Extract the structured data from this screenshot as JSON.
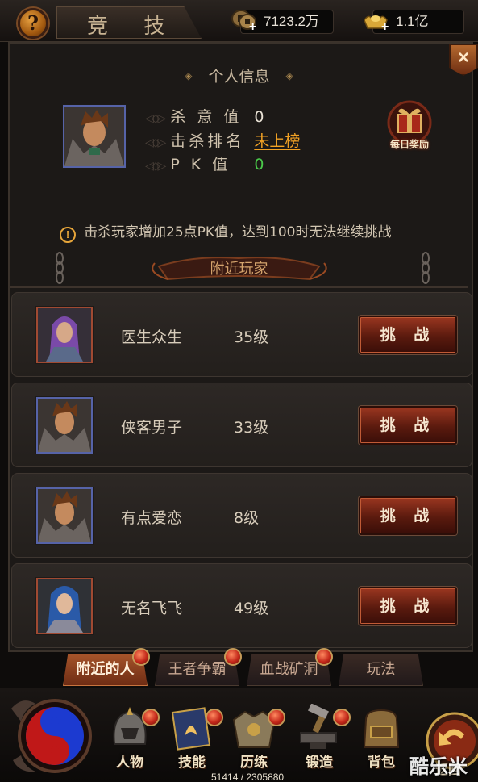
{
  "header": {
    "help_icon_glyph": "?",
    "title": "竞 技",
    "copper_value": "7123.2万",
    "gold_value": "1.1亿",
    "close_glyph": "×"
  },
  "info": {
    "section_title": "个人信息",
    "rows": [
      {
        "label": "杀 意 值",
        "value": "0"
      },
      {
        "label": "击杀排名",
        "value": "未上榜"
      },
      {
        "label": "P  K  值",
        "value": "0"
      }
    ],
    "daily_reward_label": "每日奖励",
    "notice": "击杀玩家增加25点PK值，达到100时无法继续挑战",
    "notice_icon_glyph": "!"
  },
  "nearby": {
    "title": "附近玩家",
    "players": [
      {
        "name": "医生众生",
        "level": "35级",
        "button": "挑 战"
      },
      {
        "name": "侠客男子",
        "level": "33级",
        "button": "挑 战"
      },
      {
        "name": "有点爱恋",
        "level": "8级",
        "button": "挑 战"
      },
      {
        "name": "无名飞飞",
        "level": "49级",
        "button": "挑 战"
      }
    ]
  },
  "tabs": [
    {
      "label": "附近的人",
      "active": true
    },
    {
      "label": "王者争霸",
      "active": false
    },
    {
      "label": "血战矿洞",
      "active": false
    },
    {
      "label": "玩法",
      "active": false
    }
  ],
  "dock": {
    "items": [
      "人物",
      "技能",
      "历练",
      "锻造",
      "背包"
    ],
    "back_label": "返回",
    "exp_text": "51414 / 2305880",
    "watermark": "酷乐米"
  },
  "colors": {
    "accent_orange": "#f1a124",
    "pk_green": "#4ac94a",
    "button_red": "#9a3620"
  }
}
